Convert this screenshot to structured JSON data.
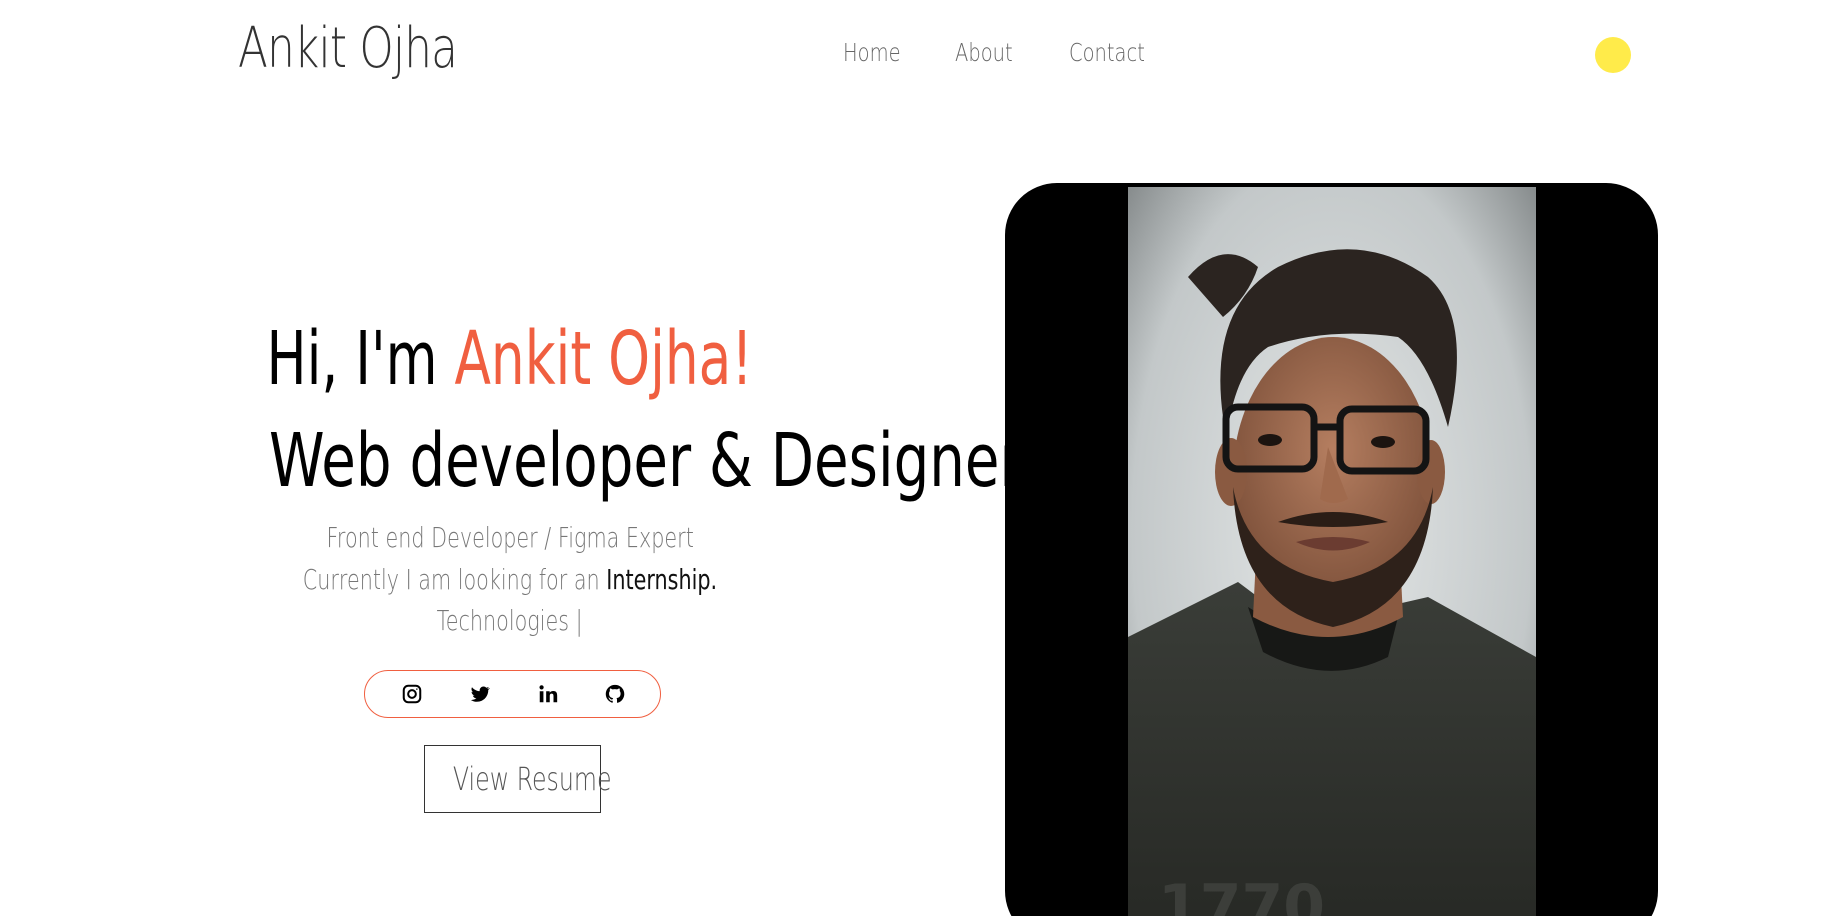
{
  "header": {
    "brand": "Ankit Ojha",
    "nav": [
      {
        "label": "Home"
      },
      {
        "label": "About"
      },
      {
        "label": "Contact"
      }
    ],
    "theme_toggle_color": "#ffeb4a"
  },
  "hero": {
    "greeting_prefix": "Hi, I'm ",
    "greeting_name": "Ankit Ojha!",
    "role": "Web developer & Designer",
    "subtitle_line1": "Front end Developer / Figma Expert",
    "subtitle_line2_prefix": "Currently I am looking for an ",
    "subtitle_line2_emphasis": "Internship.",
    "subtitle_line3": "Technologies |",
    "accent_color": "#f05f40",
    "social_icons": [
      {
        "name": "instagram-icon"
      },
      {
        "name": "twitter-icon"
      },
      {
        "name": "linkedin-icon"
      },
      {
        "name": "github-icon"
      }
    ],
    "resume_button": "View Resume"
  },
  "profile_photo": {
    "frame_color": "#000000"
  }
}
